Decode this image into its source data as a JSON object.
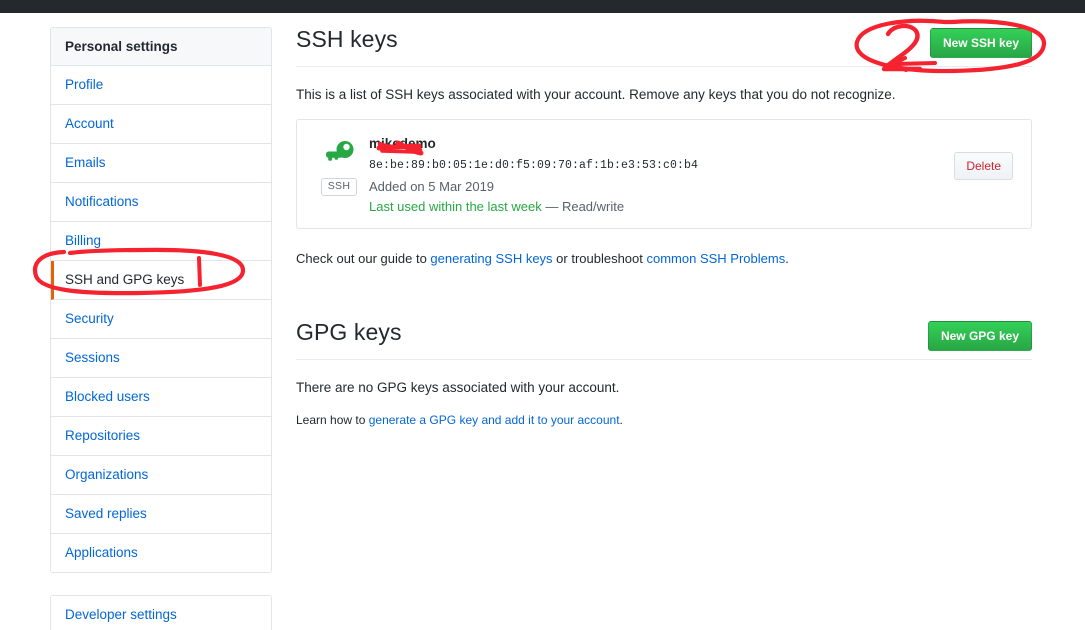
{
  "sidebar": {
    "heading": "Personal settings",
    "items": [
      {
        "label": "Profile",
        "selected": false
      },
      {
        "label": "Account",
        "selected": false
      },
      {
        "label": "Emails",
        "selected": false
      },
      {
        "label": "Notifications",
        "selected": false
      },
      {
        "label": "Billing",
        "selected": false
      },
      {
        "label": "SSH and GPG keys",
        "selected": true
      },
      {
        "label": "Security",
        "selected": false
      },
      {
        "label": "Sessions",
        "selected": false
      },
      {
        "label": "Blocked users",
        "selected": false
      },
      {
        "label": "Repositories",
        "selected": false
      },
      {
        "label": "Organizations",
        "selected": false
      },
      {
        "label": "Saved replies",
        "selected": false
      },
      {
        "label": "Applications",
        "selected": false
      }
    ],
    "developer_settings": "Developer settings"
  },
  "ssh_section": {
    "title": "SSH keys",
    "new_key_button": "New SSH key",
    "description": "This is a list of SSH keys associated with your account. Remove any keys that you do not recognize.",
    "key": {
      "icon": "key-icon",
      "badge": "SSH",
      "redacted_prefix": "mike",
      "title_visible": "demo",
      "fingerprint": "8e:be:89:b0:05:1e:d0:f5:09:70:af:1b:e3:53:c0:b4",
      "added": "Added on 5 Mar 2019",
      "last_used": "Last used within the last week",
      "permission": "— Read/write",
      "delete_button": "Delete"
    },
    "guide_note": {
      "prefix": "Check out our guide to ",
      "link1": "generating SSH keys",
      "middle": " or troubleshoot ",
      "link2": "common SSH Problems",
      "suffix": "."
    }
  },
  "gpg_section": {
    "title": "GPG keys",
    "new_key_button": "New GPG key",
    "empty_message": "There are no GPG keys associated with your account.",
    "learn": {
      "prefix": "Learn how to ",
      "link": "generate a GPG key and add it to your account",
      "suffix": "."
    }
  },
  "annotations": {
    "color": "#f4232f",
    "marks": [
      {
        "name": "ellipse-around-new-ssh-key-button",
        "shape": "ellipse"
      },
      {
        "name": "digit-2-callout",
        "shape": "text",
        "text": "2"
      },
      {
        "name": "arrow-to-new-ssh-key-button",
        "shape": "arrow"
      },
      {
        "name": "ellipse-around-ssh-and-gpg-keys",
        "shape": "ellipse"
      },
      {
        "name": "tick-mark-in-sidebar",
        "shape": "stroke"
      },
      {
        "name": "scribble-over-key-owner-name",
        "shape": "scribble"
      }
    ]
  },
  "colors": {
    "topbar": "#24292e",
    "link": "#0366d6",
    "green_button": "#28a745",
    "selected_border": "#e36209",
    "delete_text": "#cb2431",
    "annotation_red": "#f4232f"
  }
}
